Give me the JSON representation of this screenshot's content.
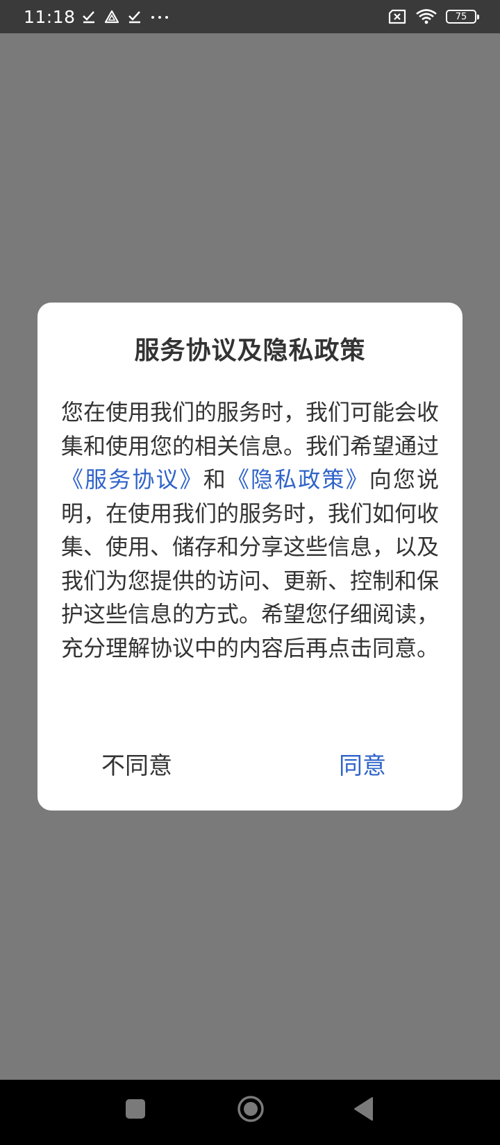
{
  "status_bar": {
    "time": "11:18",
    "left_icons": [
      "check-icon",
      "triangle-warning-icon",
      "check-icon",
      "more-dots-icon"
    ],
    "right_icons": [
      "sim-blocked-icon",
      "wifi-icon",
      "battery-icon"
    ],
    "battery_level": "75"
  },
  "dialog": {
    "title": "服务协议及隐私政策",
    "body_part1": "您在使用我们的服务时，我们可能会收集和使用您的相关信息。我们希望通过",
    "link_service": "《服务协议》",
    "body_part2": "和",
    "link_privacy": "《隐私政策》",
    "body_part3": "向您说明，在使用我们的服务时，我们如何收集、使用、储存和分享这些信息，以及我们为您提供的访问、更新、控制和保护这些信息的方式。希望您仔细阅读，充分理解协议中的内容后再点击同意。",
    "disagree_label": "不同意",
    "agree_label": "同意",
    "accent_color": "#2f63c9"
  },
  "nav_bar": {
    "icons": [
      "recent-apps-icon",
      "home-icon",
      "back-icon"
    ]
  }
}
